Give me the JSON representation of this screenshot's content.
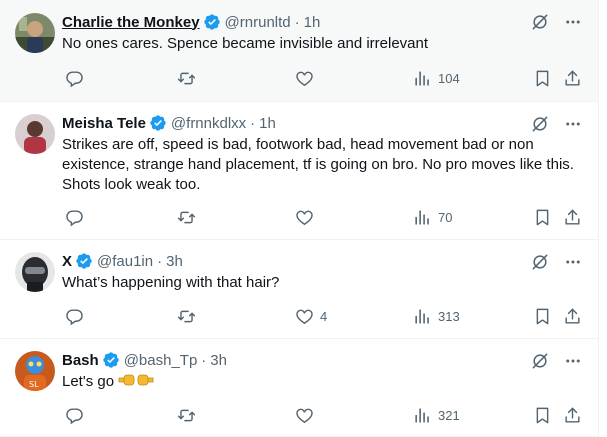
{
  "tweets": [
    {
      "name": "Charlie the Monkey",
      "handle": "@rnrunltd",
      "separator": "·",
      "time": "1h",
      "text": "No ones cares. Spence became invisible and irrelevant",
      "reply_count": "",
      "retweet_count": "",
      "like_count": "",
      "view_count": "104"
    },
    {
      "name": "Meisha Tele",
      "handle": "@frnnkdlxx",
      "separator": "·",
      "time": "1h",
      "text": "Strikes are off, speed is bad, footwork bad, head movement bad or non existence, strange hand placement, tf is going on bro. No pro moves like this. Shots look weak too.",
      "reply_count": "",
      "retweet_count": "",
      "like_count": "",
      "view_count": "70"
    },
    {
      "name": "X",
      "handle": "@fau1in",
      "separator": "·",
      "time": "3h",
      "text": "What’s happening with that hair?",
      "reply_count": "",
      "retweet_count": "",
      "like_count": "4",
      "view_count": "313"
    },
    {
      "name": "Bash",
      "handle": "@bash_Tp",
      "separator": "·",
      "time": "3h",
      "text": "Let's go",
      "reply_count": "",
      "retweet_count": "",
      "like_count": "",
      "view_count": "321"
    }
  ],
  "icons": {
    "verified": "verified-badge-icon",
    "grok": "grok-icon",
    "more": "more-icon",
    "reply": "reply-icon",
    "retweet": "retweet-icon",
    "like": "like-icon",
    "views": "views-icon",
    "bookmark": "bookmark-icon",
    "share": "share-icon"
  },
  "colors": {
    "verified": "#1d9bf0",
    "secondary_text": "#536471",
    "primary_text": "#0f1419",
    "hover_background": "#f7f9f9"
  }
}
